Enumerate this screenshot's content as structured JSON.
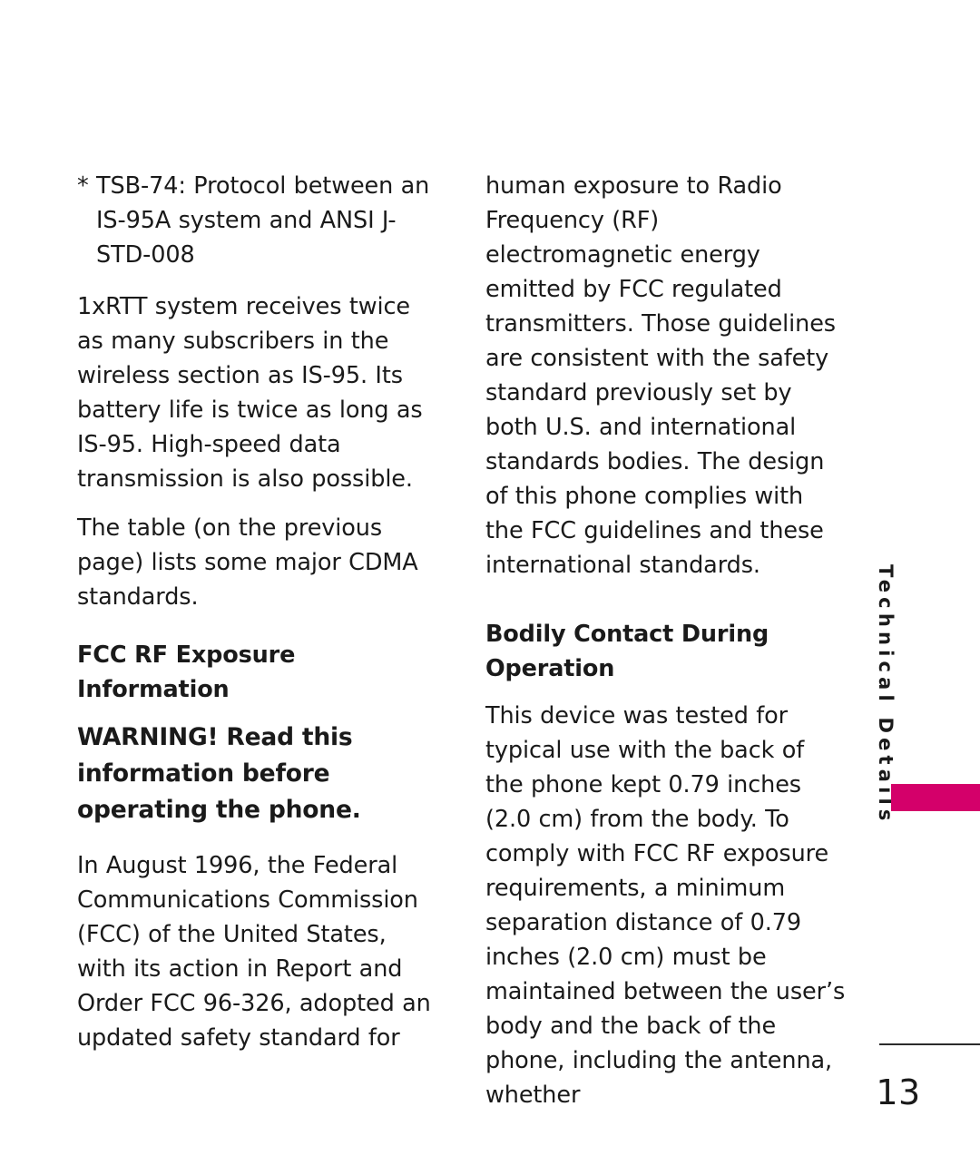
{
  "document": {
    "section_tab": "Technical Details",
    "page_number": "13",
    "accent_color": "#d4006a",
    "text_color": "#1a1a1a",
    "background_color": "#ffffff"
  },
  "left_column": {
    "footnote": "* TSB-74: Protocol between an IS-95A system and ANSI J-STD-008",
    "para_1xrtt": "1xRTT system receives twice as many subscribers in the wireless section as IS-95. Its battery life is twice as long as IS-95. High-speed data transmission is also possible.",
    "para_table": "The table (on the previous page) lists some major CDMA standards.",
    "heading_fcc_rf": "FCC RF Exposure Information",
    "warning": "WARNING! Read this information before operating the phone.",
    "para_august": "In August 1996, the Federal Communications Commission (FCC) of the United States, with its action in Report and Order FCC 96-326, adopted an updated safety standard for"
  },
  "right_column": {
    "para_human_exposure": "human exposure to Radio Frequency (RF) electromagnetic energy emitted by FCC regulated transmitters. Those guidelines are consistent with the safety standard previously set by both U.S. and international standards bodies. The design of this phone complies with the FCC guidelines and these international standards.",
    "heading_bodily_contact": "Bodily Contact During Operation",
    "para_tested": "This device was tested for typical use with the back of the phone kept 0.79 inches (2.0 cm) from the body. To comply with FCC RF exposure requirements, a minimum separation distance of 0.79 inches (2.0 cm) must be maintained between the user’s body and the back of the phone, including the antenna, whether"
  }
}
